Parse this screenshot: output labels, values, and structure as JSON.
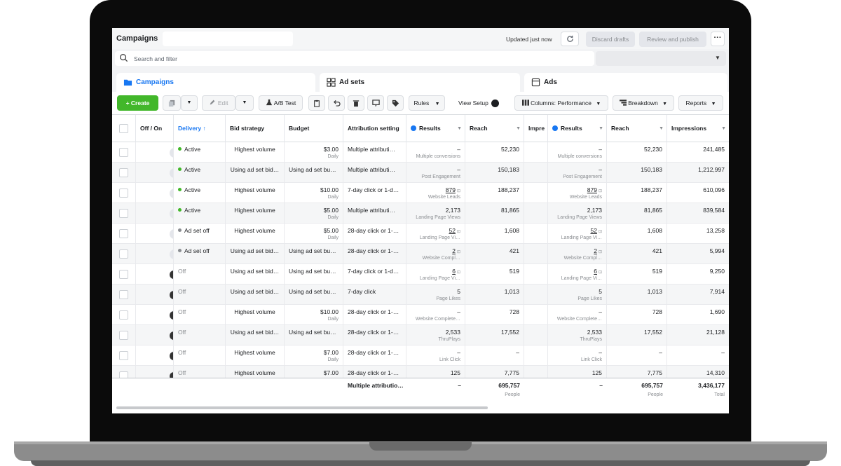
{
  "header": {
    "title": "Campaigns",
    "updated": "Updated just now",
    "discard_label": "Discard drafts",
    "review_label": "Review and publish",
    "more_label": "···"
  },
  "search": {
    "placeholder": "Search and filter"
  },
  "tabs": [
    {
      "label": "Campaigns"
    },
    {
      "label": "Ad sets"
    },
    {
      "label": "Ads"
    }
  ],
  "toolbar": {
    "create": "+ Create",
    "edit": "Edit",
    "ab_test": "A/B Test",
    "rules": "Rules",
    "view_setup": "View Setup",
    "columns": "Columns: Performance",
    "breakdown": "Breakdown",
    "reports": "Reports"
  },
  "columns": {
    "off_on": "Off / On",
    "delivery": "Delivery ↑",
    "bid_strategy": "Bid strategy",
    "budget": "Budget",
    "attribution": "Attribution setting",
    "results": "Results",
    "reach": "Reach",
    "impressions_cut": "Impre",
    "results2": "Results",
    "reach2": "Reach",
    "impressions": "Impressions"
  },
  "rows": [
    {
      "on": true,
      "delivery": "Active",
      "status_color": "#42b72a",
      "bid": "Highest volume",
      "budget": "$3.00",
      "budget_sub": "Daily",
      "attr": "Multiple attributi…",
      "results": "–",
      "results_sub": "Multiple conversions",
      "reach": "52,230",
      "impressions": "241,485"
    },
    {
      "on": true,
      "delivery": "Active",
      "status_color": "#42b72a",
      "bid": "Using ad set bid…",
      "budget": "Using ad set bu…",
      "budget_sub": "",
      "attr": "Multiple attributi…",
      "results": "–",
      "results_sub": "Post Engagement",
      "reach": "150,183",
      "impressions": "1,212,997"
    },
    {
      "on": true,
      "delivery": "Active",
      "status_color": "#42b72a",
      "bid": "Highest volume",
      "budget": "$10.00",
      "budget_sub": "Daily",
      "attr": "7-day click or 1-d…",
      "results": "879",
      "results_sub": "Website Leads",
      "reach": "188,237",
      "impressions": "610,096"
    },
    {
      "on": true,
      "delivery": "Active",
      "status_color": "#42b72a",
      "bid": "Highest volume",
      "budget": "$5.00",
      "budget_sub": "Daily",
      "attr": "Multiple attributi…",
      "results": "2,173",
      "results_sub": "Landing Page Views",
      "reach": "81,865",
      "impressions": "839,584"
    },
    {
      "on": true,
      "delivery": "Ad set off",
      "status_color": "#8a8d91",
      "bid": "Highest volume",
      "budget": "$5.00",
      "budget_sub": "Daily",
      "attr": "28-day click or 1-…",
      "results": "52",
      "results_sub": "Landing Page Vi…",
      "reach": "1,608",
      "impressions": "13,258"
    },
    {
      "on": true,
      "delivery": "Ad set off",
      "status_color": "#8a8d91",
      "bid": "Using ad set bid…",
      "budget": "Using ad set bu…",
      "budget_sub": "",
      "attr": "28-day click or 1-…",
      "results": "2",
      "results_sub": "Website Compl…",
      "reach": "421",
      "impressions": "5,994"
    },
    {
      "on": false,
      "delivery": "Off",
      "status_color": "",
      "bid": "Using ad set bid…",
      "budget": "Using ad set bu…",
      "budget_sub": "",
      "attr": "7-day click or 1-d…",
      "results": "6",
      "results_sub": "Landing Page Vi…",
      "reach": "519",
      "impressions": "9,250"
    },
    {
      "on": false,
      "delivery": "Off",
      "status_color": "",
      "bid": "Using ad set bid…",
      "budget": "Using ad set bu…",
      "budget_sub": "",
      "attr": "7-day click",
      "results": "5",
      "results_sub": "Page Likes",
      "reach": "1,013",
      "impressions": "7,914"
    },
    {
      "on": false,
      "delivery": "Off",
      "status_color": "",
      "bid": "Highest volume",
      "budget": "$10.00",
      "budget_sub": "Daily",
      "attr": "28-day click or 1-…",
      "results": "–",
      "results_sub": "Website Complete…",
      "reach": "728",
      "impressions": "1,690"
    },
    {
      "on": false,
      "delivery": "Off",
      "status_color": "",
      "bid": "Using ad set bid…",
      "budget": "Using ad set bu…",
      "budget_sub": "",
      "attr": "28-day click or 1-…",
      "results": "2,533",
      "results_sub": "ThruPlays",
      "reach": "17,552",
      "impressions": "21,128"
    },
    {
      "on": false,
      "delivery": "Off",
      "status_color": "",
      "bid": "Highest volume",
      "budget": "$7.00",
      "budget_sub": "Daily",
      "attr": "28-day click or 1-…",
      "results": "–",
      "results_sub": "Link Click",
      "reach": "–",
      "impressions": "–"
    },
    {
      "on": false,
      "delivery": "Off",
      "status_color": "",
      "bid": "Highest volume",
      "budget": "$7.00",
      "budget_sub": "",
      "attr": "28-day click or 1-…",
      "results": "125",
      "results_sub": "",
      "reach": "7,775",
      "impressions": "14,310"
    }
  ],
  "underlined_results": [
    "879",
    "52",
    "2",
    "6"
  ],
  "totals": {
    "attr": "Multiple attributio…",
    "results": "–",
    "reach": "695,757",
    "reach_sub": "People",
    "results2": "–",
    "reach2": "695,757",
    "reach2_sub": "People",
    "impressions": "3,436,177",
    "impressions_sub": "Total"
  },
  "colors": {
    "accent": "#1877f2",
    "create": "#42b72a"
  }
}
